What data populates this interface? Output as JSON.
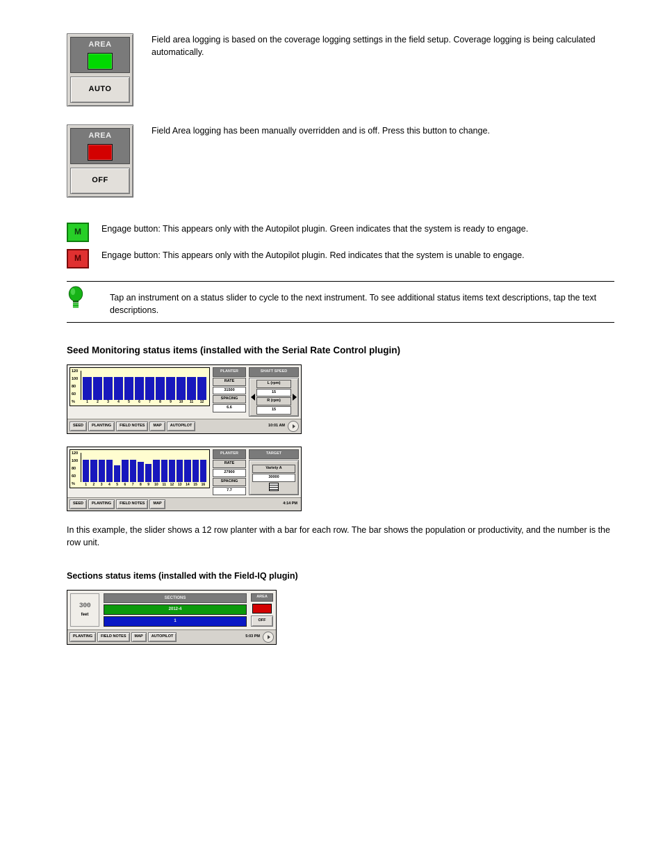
{
  "items": [
    {
      "area": {
        "title": "AREA",
        "color": "green",
        "btn": "AUTO"
      },
      "desc": "Field area logging is based on the coverage logging settings in the field setup. Coverage logging is being calculated automatically."
    },
    {
      "area": {
        "title": "AREA",
        "color": "red",
        "btn": "OFF"
      },
      "desc": "Field Area logging has been manually overridden and is off. Press this button to change."
    }
  ],
  "m_green": {
    "letter": "M",
    "desc": "Engage button: This appears only with the Autopilot plugin. Green indicates that the system is ready to engage."
  },
  "m_red": {
    "letter": "M",
    "desc": "Engage button: This appears only with the Autopilot plugin. Red indicates that the system is unable to engage."
  },
  "tip_text": "Tap an instrument on a status slider to cycle to the next instrument. To see additional status items text descriptions, tap the text descriptions.",
  "h_seed": "Seed Monitoring status items (installed with the Serial Rate Control plugin)",
  "scr1": {
    "yticks": [
      "120",
      "100",
      "80",
      "60",
      "%"
    ],
    "bar_labels": [
      "1",
      "2",
      "3",
      "4",
      "5",
      "6",
      "7",
      "8",
      "9",
      "10",
      "11",
      "12"
    ],
    "bar_heights_pct": [
      78,
      78,
      78,
      78,
      78,
      78,
      78,
      78,
      78,
      78,
      78,
      78
    ],
    "planter_head": "PLANTER",
    "rate_label": "RATE",
    "rate_value": "31500",
    "spacing_label": "SPACING",
    "spacing_value": "6.6",
    "speed_head": "SHAFT SPEED",
    "l_label": "L (rpm)",
    "l_val": "15",
    "r_label": "R (rpm)",
    "r_val": "15",
    "tabs": [
      "SEED",
      "PLANTING",
      "FIELD NOTES",
      "MAP",
      "AUTOPILOT"
    ],
    "time": "10:01 AM"
  },
  "scr2": {
    "yticks": [
      "120",
      "100",
      "80",
      "60",
      "%"
    ],
    "bar_labels": [
      "1",
      "2",
      "3",
      "4",
      "5",
      "6",
      "7",
      "8",
      "9",
      "10",
      "11",
      "12",
      "13",
      "14",
      "15",
      "16"
    ],
    "bar_heights_pct": [
      78,
      78,
      78,
      78,
      58,
      78,
      78,
      70,
      64,
      78,
      78,
      78,
      78,
      78,
      78,
      78
    ],
    "planter_head": "PLANTER",
    "rate_label": "RATE",
    "rate_value": "27900",
    "spacing_label": "SPACING",
    "spacing_value": "7.7",
    "target_head": "TARGET",
    "target_variety": "Variety A",
    "target_value": "30000",
    "tabs": [
      "SEED",
      "PLANTING",
      "FIELD NOTES",
      "MAP"
    ],
    "time": "4:14 PM"
  },
  "seed_caption": "In this example, the slider shows a 12 row planter with a bar for each row. The bar shows the population or productivity, and the number is the row unit.",
  "h_sections": "Sections status items (installed with the Field-IQ plugin)",
  "scr3": {
    "pop_value": "300",
    "pop_label": "feet",
    "sections_head": "SECTIONS",
    "bar1": "2012-4",
    "bar2": "1",
    "area": {
      "title": "AREA",
      "btn": "OFF"
    },
    "tabs": [
      "PLANTING",
      "FIELD NOTES",
      "MAP",
      "AUTOPILOT"
    ],
    "time": "5:03 PM"
  }
}
